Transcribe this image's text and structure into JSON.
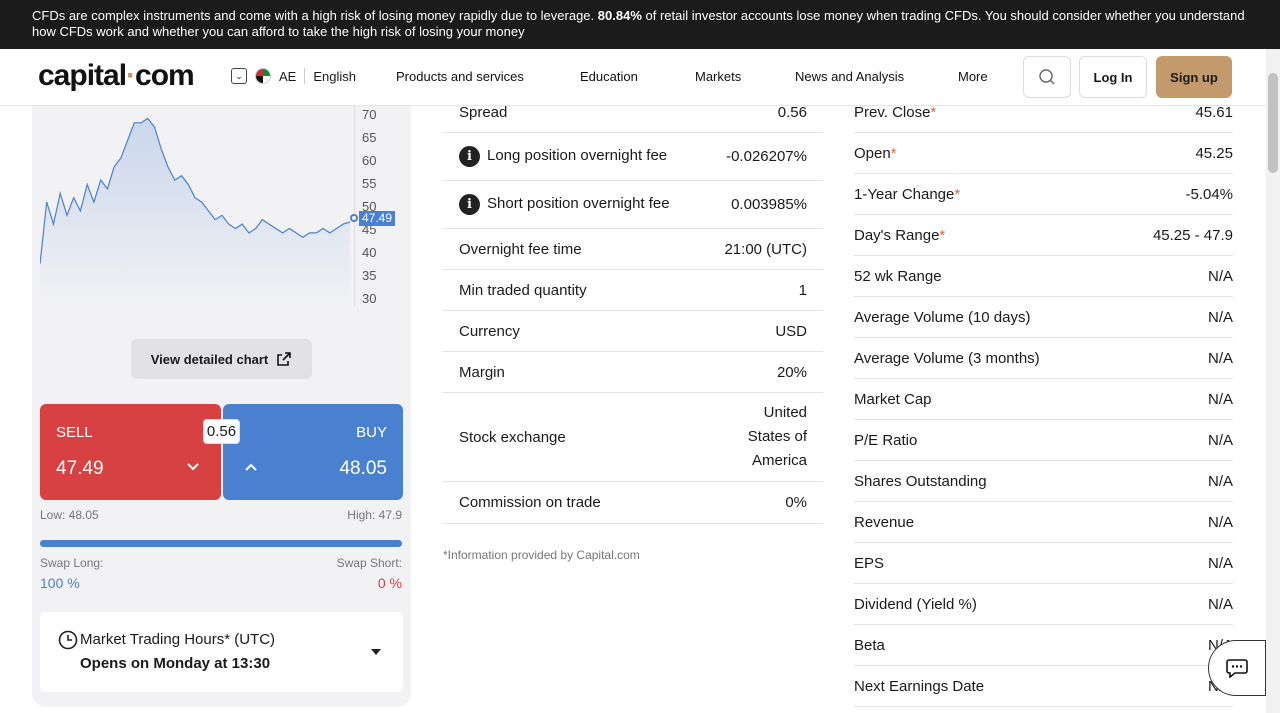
{
  "risk": {
    "pre": "CFDs are complex instruments and come with a high risk of losing money rapidly due to leverage.",
    "pct": "80.84%",
    "post": "of retail investor accounts lose money when trading CFDs. You should consider whether you understand how CFDs work and whether you can afford to take the high risk of losing your money"
  },
  "nav": {
    "logo_a": "capital",
    "logo_dot": "·",
    "logo_b": "com",
    "region": "AE",
    "language": "English",
    "items": [
      "Products and services",
      "Education",
      "Markets",
      "News and Analysis",
      "More"
    ],
    "login": "Log In",
    "signup": "Sign up"
  },
  "chart": {
    "ticks": [
      "70",
      "65",
      "60",
      "55",
      "50",
      "45",
      "40",
      "35",
      "30"
    ],
    "last_price": "47.49",
    "button": "View detailed chart"
  },
  "chart_data": {
    "type": "area",
    "ylim": [
      30,
      72
    ],
    "values": [
      38,
      52,
      47,
      54,
      49,
      53,
      50,
      56,
      52,
      57,
      55,
      60,
      62,
      66,
      70,
      70,
      71,
      69,
      64,
      60,
      57,
      58,
      56,
      53,
      52,
      50,
      48,
      49,
      47,
      46,
      47,
      45,
      46,
      48,
      47,
      46,
      45,
      46,
      45,
      44,
      45,
      45,
      46,
      45,
      46,
      47,
      47.49
    ],
    "color": "#4a80d0"
  },
  "trade": {
    "sell_label": "SELL",
    "sell_price": "47.49",
    "buy_label": "BUY",
    "buy_price": "48.05",
    "spread": "0.56",
    "low": "Low: 48.05",
    "high": "High: 47.9",
    "swap_long_label": "Swap Long:",
    "swap_long_value": "100 %",
    "swap_short_label": "Swap Short:",
    "swap_short_value": "0 %",
    "long_ratio": 1.0
  },
  "hours": {
    "title": "Market Trading Hours* (UTC)",
    "status": "Opens on Monday at 13:30"
  },
  "specs": [
    {
      "label": "Spread",
      "value": "0.56"
    },
    {
      "label": "Long position overnight fee",
      "value": "-0.026207%"
    },
    {
      "label": "Short position overnight fee",
      "value": "0.003985%"
    },
    {
      "label": "Overnight fee time",
      "value": "21:00 (UTC)"
    },
    {
      "label": "Min traded quantity",
      "value": "1"
    },
    {
      "label": "Currency",
      "value": "USD"
    },
    {
      "label": "Margin",
      "value": "20%"
    },
    {
      "label": "Stock exchange",
      "value_l1": "United",
      "value_l2": "States of",
      "value_l3": "America"
    },
    {
      "label": "Commission on trade",
      "value": "0%"
    }
  ],
  "note": "*Information provided by Capital.com",
  "stats": [
    {
      "label": "Prev. Close",
      "value": "45.61",
      "star": "*"
    },
    {
      "label": "Open",
      "value": "45.25",
      "star": "*"
    },
    {
      "label": "1-Year Change",
      "value": "-5.04%",
      "star": "*"
    },
    {
      "label": "Day's Range",
      "value": "45.25 - 47.9",
      "star": "*"
    },
    {
      "label": "52 wk Range",
      "value": "N/A"
    },
    {
      "label": "Average Volume (10 days)",
      "value": "N/A"
    },
    {
      "label": "Average Volume (3 months)",
      "value": "N/A"
    },
    {
      "label": "Market Cap",
      "value": "N/A"
    },
    {
      "label": "P/E Ratio",
      "value": "N/A"
    },
    {
      "label": "Shares Outstanding",
      "value": "N/A"
    },
    {
      "label": "Revenue",
      "value": "N/A"
    },
    {
      "label": "EPS",
      "value": "N/A"
    },
    {
      "label": "Dividend (Yield %)",
      "value": "N/A"
    },
    {
      "label": "Beta",
      "value": "N/A"
    },
    {
      "label": "Next Earnings Date",
      "value": "N/A"
    }
  ]
}
